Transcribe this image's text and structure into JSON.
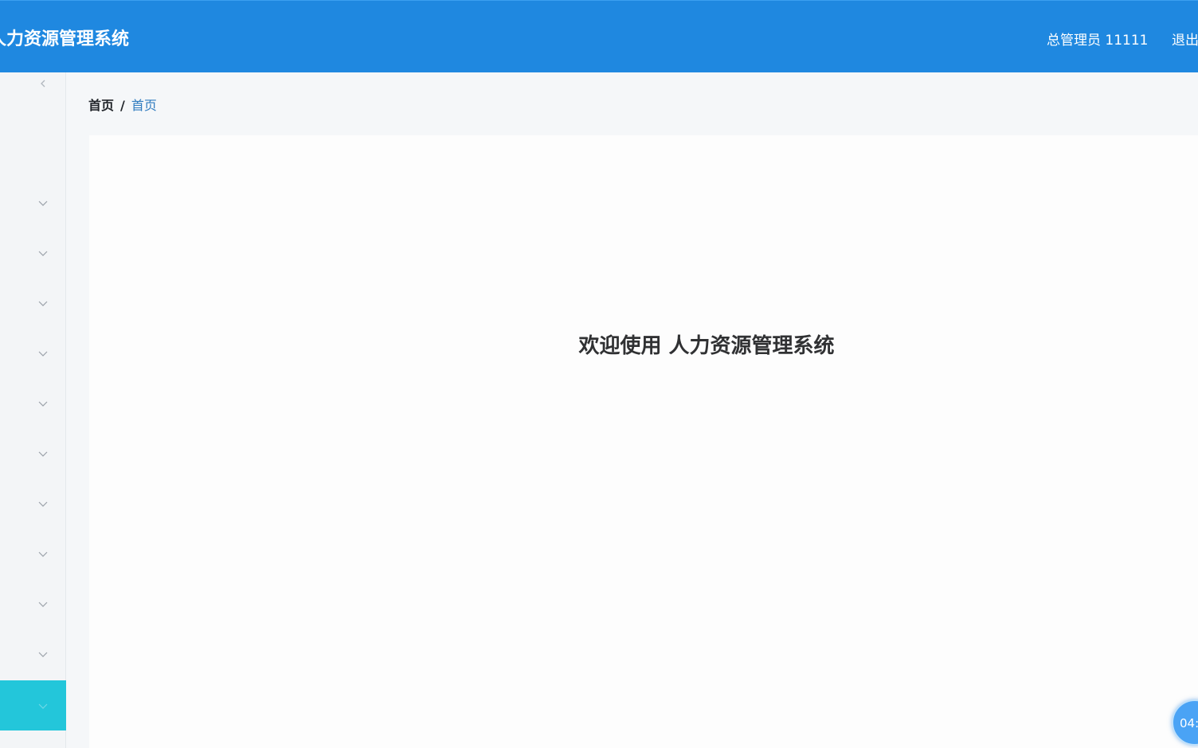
{
  "header": {
    "title": "人力资源管理系统",
    "user": "总管理员 11111",
    "logout": "退出"
  },
  "breadcrumb": {
    "home": "首页",
    "separator": "/",
    "current": "首页"
  },
  "main": {
    "welcome": "欢迎使用 人力资源管理系统"
  },
  "floating_timer": {
    "label": "04:"
  },
  "sidebar": {
    "collapse_icon": "chevron-left-icon",
    "items": [
      {
        "icon": "chevron-down-icon"
      },
      {
        "icon": "chevron-down-icon"
      },
      {
        "icon": "chevron-down-icon"
      },
      {
        "icon": "chevron-down-icon"
      },
      {
        "icon": "chevron-down-icon"
      },
      {
        "icon": "chevron-down-icon"
      },
      {
        "icon": "chevron-down-icon"
      },
      {
        "icon": "chevron-down-icon"
      },
      {
        "icon": "chevron-down-icon"
      },
      {
        "icon": "chevron-down-icon"
      },
      {
        "icon": "chevron-down-icon",
        "active": true
      }
    ]
  },
  "colors": {
    "header_bg": "#1f88e0",
    "sidebar_active": "#23c6da",
    "breadcrumb_current": "#2f7bbf"
  }
}
